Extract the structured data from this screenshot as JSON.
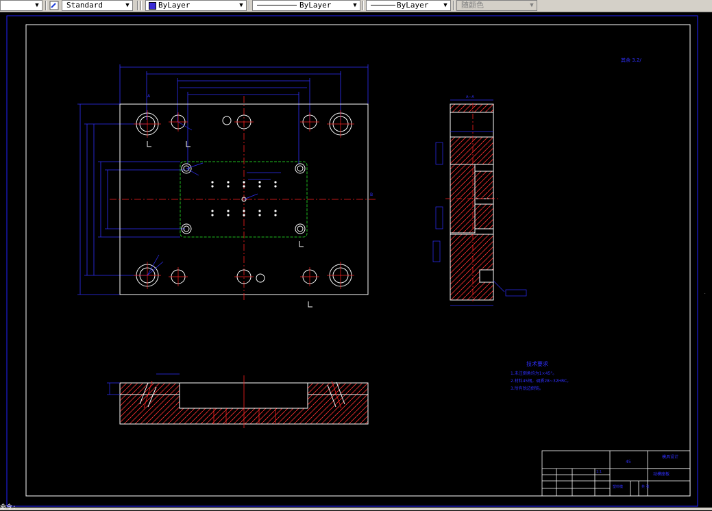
{
  "toolbar": {
    "text_style": "Standard",
    "layer_color": "ByLayer",
    "linetype": "ByLayer",
    "lineweight": "ByLayer",
    "plot_style": "随颜色",
    "text_style_icon": "text-style-icon",
    "colors": {
      "toolbar_bg": "#d4d0c8",
      "swatch": "#3a2bd6"
    }
  },
  "drawing": {
    "background": "#000000",
    "frame_color": "#2222ff",
    "geometry_color": "#ffffff",
    "dimension_color": "#3030ff",
    "centerline_color": "#ff2020",
    "highlight_color": "#20c020",
    "section_top_label": "A—A",
    "section_mark_a": "A",
    "section_mark_b": "B",
    "tech_title": "技术要求",
    "tech_lines": [
      "1.未注倒角均为1×45°。",
      "2.材料45钢，调质28~32HRC。",
      "3.所有锐边倒钝。"
    ],
    "roughness_note": "其余 3.2/"
  },
  "title_block": {
    "drawing_name": "动模座板",
    "part_name": "塑料模",
    "company": "模具设计",
    "scale_label": "比例",
    "scale_value": "1:1",
    "sheet_label": "共 张",
    "material": "45"
  },
  "status_bar": {
    "text": "命令:"
  }
}
